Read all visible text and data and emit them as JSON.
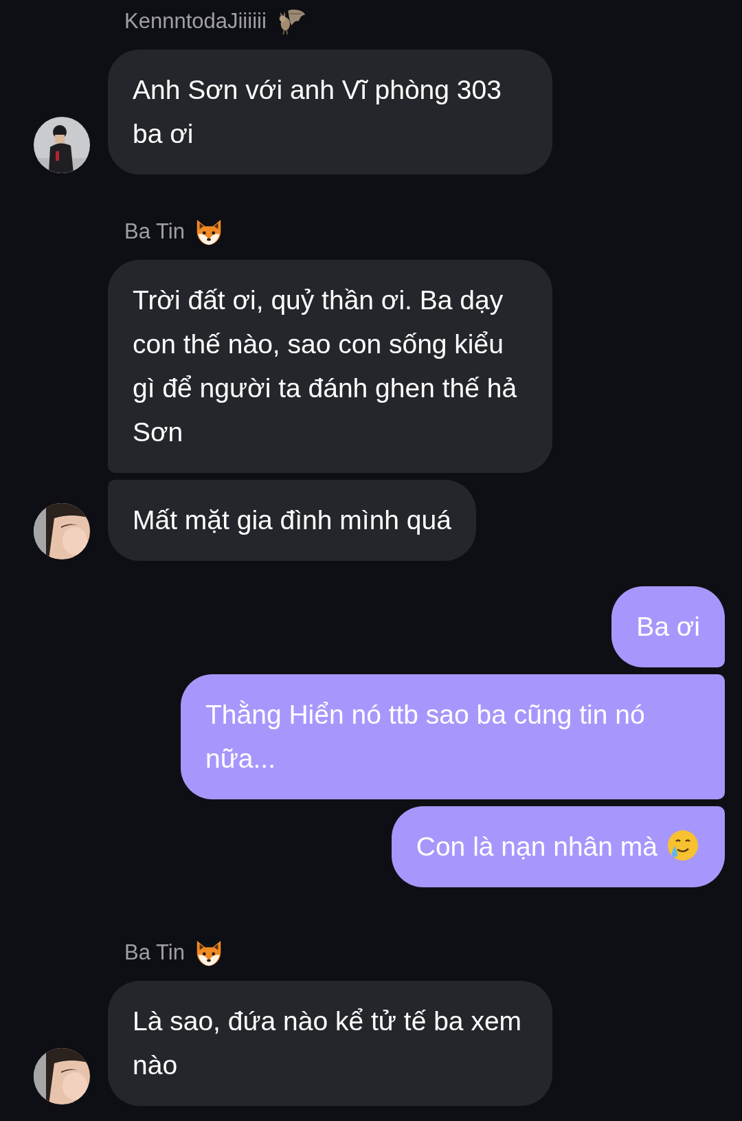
{
  "groups": [
    {
      "kind": "incoming",
      "sender": {
        "name": "KennntodaJiiiiii",
        "kind": "bat"
      },
      "avatar": {
        "kind": "picture"
      },
      "messages": [
        {
          "text": "Anh Sơn với anh Vĩ phòng 303 ba ơi",
          "kind": "text"
        }
      ]
    },
    {
      "kind": "incoming",
      "sender": {
        "name": "Ba Tin",
        "kind": "fox"
      },
      "avatar": {
        "kind": "picture"
      },
      "messages": [
        {
          "text": "Trời đất ơi, quỷ thần ơi. Ba dạy con thế nào, sao con sống kiểu gì để người ta đánh ghen thế hả Sơn",
          "kind": "text"
        },
        {
          "text": "Mất mặt gia đình mình quá",
          "kind": "text"
        }
      ]
    },
    {
      "kind": "outgoing",
      "messages": [
        {
          "text": "Ba ơi",
          "kind": "text"
        },
        {
          "text": "Thằng Hiển nó ttb sao ba cũng tin nó nữa...",
          "kind": "text"
        },
        {
          "text": "Con là nạn nhân mà",
          "kind": "emoji_tear_smile"
        }
      ]
    },
    {
      "kind": "incoming",
      "sender": {
        "name": "Ba Tin",
        "kind": "fox"
      },
      "avatar": {
        "kind": "picture"
      },
      "messages": [
        {
          "text": "Là sao, đứa nào kể tử tế ba xem nào",
          "kind": "text"
        }
      ]
    }
  ]
}
